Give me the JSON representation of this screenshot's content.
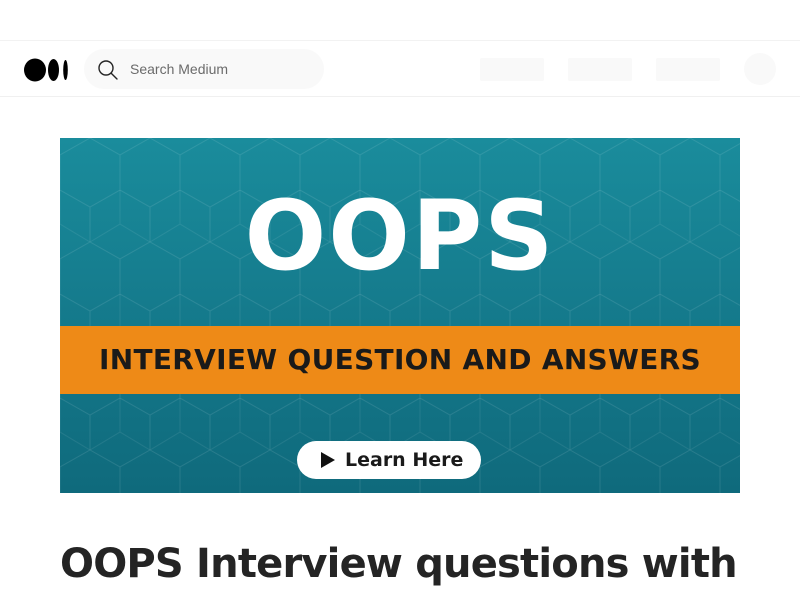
{
  "search": {
    "placeholder": "Search Medium"
  },
  "hero": {
    "title": "OOPS",
    "band_text": "INTERVIEW QUESTION AND ANSWERS",
    "button_label": "Learn Here",
    "colors": {
      "background": "#168495",
      "band": "#ee8a17",
      "button": "#ffffff"
    }
  },
  "article": {
    "title": "OOPS Interview questions with"
  },
  "icons": {
    "logo": "medium-logo-icon",
    "search": "search-icon",
    "play": "play-icon"
  }
}
